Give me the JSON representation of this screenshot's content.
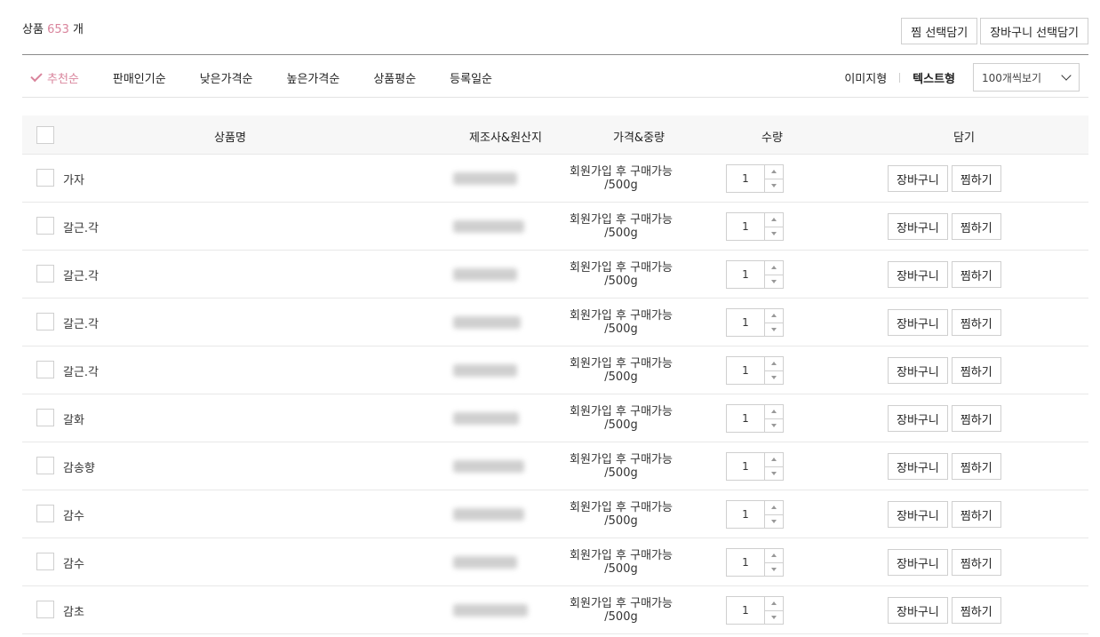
{
  "header": {
    "count_prefix": "상품",
    "count": "653",
    "count_suffix": "개",
    "wish_select_label": "찜 선택담기",
    "cart_select_label": "장바구니 선택담기"
  },
  "sort": {
    "options": [
      {
        "label": "추천순",
        "active": true
      },
      {
        "label": "판매인기순",
        "active": false
      },
      {
        "label": "낮은가격순",
        "active": false
      },
      {
        "label": "높은가격순",
        "active": false
      },
      {
        "label": "상품평순",
        "active": false
      },
      {
        "label": "등록일순",
        "active": false
      }
    ],
    "view_image": "이미지형",
    "view_text": "텍스트형",
    "page_size": "100개씩보기"
  },
  "table": {
    "headers": {
      "name": "상품명",
      "maker": "제조사&원산지",
      "price": "가격&중량",
      "qty": "수량",
      "add": "담기"
    },
    "rows": [
      {
        "name": "가자",
        "price": "회원가입 후 구매가능",
        "weight": "/500g",
        "qty": "1"
      },
      {
        "name": "갈근.각",
        "price": "회원가입 후 구매가능",
        "weight": "/500g",
        "qty": "1"
      },
      {
        "name": "갈근.각",
        "price": "회원가입 후 구매가능",
        "weight": "/500g",
        "qty": "1"
      },
      {
        "name": "갈근.각",
        "price": "회원가입 후 구매가능",
        "weight": "/500g",
        "qty": "1"
      },
      {
        "name": "갈근.각",
        "price": "회원가입 후 구매가능",
        "weight": "/500g",
        "qty": "1"
      },
      {
        "name": "갈화",
        "price": "회원가입 후 구매가능",
        "weight": "/500g",
        "qty": "1"
      },
      {
        "name": "감송향",
        "price": "회원가입 후 구매가능",
        "weight": "/500g",
        "qty": "1"
      },
      {
        "name": "감수",
        "price": "회원가입 후 구매가능",
        "weight": "/500g",
        "qty": "1"
      },
      {
        "name": "감수",
        "price": "회원가입 후 구매가능",
        "weight": "/500g",
        "qty": "1"
      },
      {
        "name": "감초",
        "price": "회원가입 후 구매가능",
        "weight": "/500g",
        "qty": "1"
      }
    ],
    "cart_label": "장바구니",
    "wish_label": "찜하기"
  },
  "colors": {
    "accent": "#d9849c",
    "border": "#cfcfcf",
    "header_bg": "#f7f7f7"
  }
}
